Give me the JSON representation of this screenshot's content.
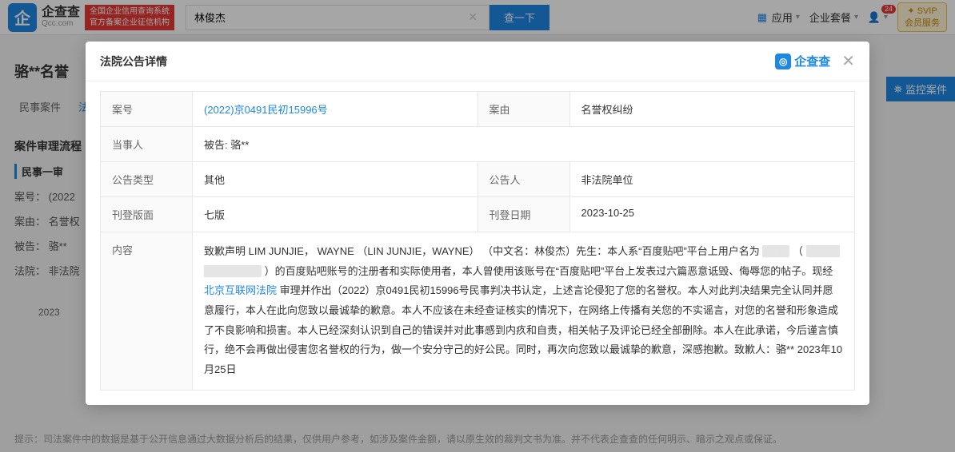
{
  "header": {
    "logo_name": "企查查",
    "logo_domain": "Qcc.com",
    "slogan_line1": "全国企业信用查询系统",
    "slogan_line2": "官方备案企业征信机构",
    "search_value": "林俊杰",
    "search_button": "查一下",
    "nav_app": "应用",
    "nav_package": "企业套餐",
    "badge_count": "24",
    "svip_line1": "✦ SVIP",
    "svip_line2": "会员服务"
  },
  "bg": {
    "page_title": "骆**名誉",
    "tab1": "民事案件",
    "tab2": "法",
    "section_title": "案件审理流程",
    "section_sub": "民事一审",
    "row_caseno": "案号： (2022",
    "row_reason": "案由： 名誉权",
    "row_defendant": "被告： 骆**",
    "row_court": "法院： 非法院",
    "timeline_date": "2023",
    "monitor_btn": "监控案件",
    "footer_tip": "提示：司法案件中的数据是基于公开信息通过大数据分析后的结果，仅供用户参考，如涉及案件金额，请以原生效的裁判文书为准。并不代表企查查的任何明示、暗示之观点或保证。"
  },
  "modal": {
    "title": "法院公告详情",
    "brand": "企查查",
    "rows": {
      "case_no": {
        "label": "案号",
        "value": "(2022)京0491民初15996号"
      },
      "reason": {
        "label": "案由",
        "value": "名誉权纠纷"
      },
      "parties": {
        "label": "当事人",
        "value": "被告: 骆**"
      },
      "notice_type": {
        "label": "公告类型",
        "value": "其他"
      },
      "notice_person": {
        "label": "公告人",
        "value": "非法院单位"
      },
      "page": {
        "label": "刊登版面",
        "value": "七版"
      },
      "pub_date": {
        "label": "刊登日期",
        "value": "2023-10-25"
      },
      "content": {
        "label": "内容"
      }
    },
    "content": {
      "p1a": "致歉声明 LIM JUNJIE， WAYNE （LIN JUNJIE，WAYNE） （中文名：林俊杰）先生：本人系“百度贴吧”平台上用户名为",
      "redact1": "▇▇▇",
      "p1b": "（",
      "redact2": "▇▇▇▇  ▇▇▇▇▇▇▇",
      "p1c": "）的百度贴吧账号的注册者和实际使用者，本人曾使用该账号在“百度贴吧”平台上发表过六篇恶意诋毁、侮辱您的帖子。现经",
      "link": "北京互联网法院",
      "p1d": "审理并作出（2022）京0491民初15996号民事判决书认定，上述言论侵犯了您的名誉权。本人对此判决结果完全认同并愿意履行，本人在此向您致以最诚挚的歉意。本人不应该在未经查证核实的情况下，在网络上传播有关您的不实谣言，对您的名誉和形象造成了不良影响和损害。本人已经深刻认识到自己的错误并对此事感到内疚和自责，相关帖子及评论已经全部删除。本人在此承诺，今后谨言慎行，绝不会再做出侵害您名誉权的行为，做一个安分守己的好公民。同时，再次向您致以最诚挚的歉意，深感抱歉。致歉人：骆** 2023年10月25日"
    }
  }
}
